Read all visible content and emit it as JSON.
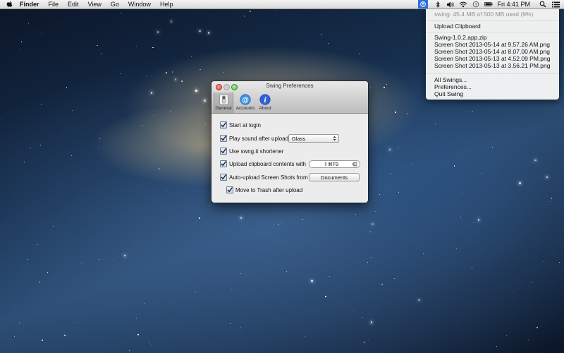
{
  "menubar": {
    "app_name": "Finder",
    "menus": [
      "File",
      "Edit",
      "View",
      "Go",
      "Window",
      "Help"
    ],
    "clock": "Fri 4:41 PM",
    "status_icons": [
      "swing-icon",
      "bluetooth-icon",
      "volume-icon",
      "wifi-icon",
      "time-machine-icon",
      "battery-icon",
      "search-icon",
      "list-icon"
    ]
  },
  "dropdown": {
    "usage": "swing: 45.4 MB of 500 MB used (9%)",
    "upload_clipboard": "Upload Clipboard",
    "recent_files": [
      "Swing-1.0.2.app.zip",
      "Screen Shot 2013-05-14 at 9.57.26 AM.png",
      "Screen Shot 2013-05-14 at 8.07.00 AM.png",
      "Screen Shot 2013-05-13 at 4.52.09 PM.png",
      "Screen Shot 2013-05-13 at 3.56.21 PM.png"
    ],
    "all_swings": "All Swings...",
    "preferences": "Preferences...",
    "quit": "Quit Swing"
  },
  "prefs_window": {
    "title": "Swing Preferences",
    "tabs": [
      {
        "label": "General",
        "icon": "switch-icon",
        "selected": true
      },
      {
        "label": "Accounts",
        "icon": "at-sign-icon",
        "selected": false
      },
      {
        "label": "About",
        "icon": "info-icon",
        "selected": false
      }
    ],
    "start_at_login": {
      "label": "Start at login",
      "checked": true
    },
    "play_sound": {
      "label": "Play sound after upload",
      "checked": true,
      "sound_value": "Glass"
    },
    "use_shortener": {
      "label": "Use swng.it shortener",
      "checked": true
    },
    "upload_clipboard": {
      "label": "Upload clipboard contents with",
      "checked": true,
      "shortcut": "⇧⌘F9"
    },
    "auto_upload": {
      "label": "Auto-upload Screen Shots from",
      "checked": true,
      "folder": "Documents"
    },
    "move_to_trash": {
      "label": "Move to Trash after upload",
      "checked": true
    }
  },
  "colors": {
    "selection_blue": "#2f6fd8",
    "accounts_blue": "#3b8fe0",
    "about_blue": "#2f62d8"
  }
}
